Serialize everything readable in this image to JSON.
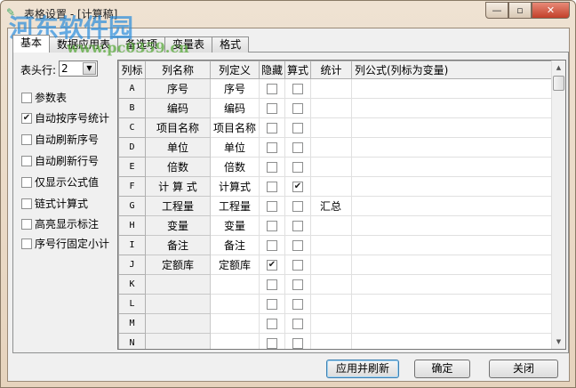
{
  "window": {
    "title": "表格设置 - [计算稿]",
    "minimize": "—",
    "maximize": "▫",
    "close": "✕"
  },
  "watermark": {
    "site": "河东软件园",
    "url": "www.pc0359.cn"
  },
  "tabs": [
    {
      "label": "基本",
      "active": true
    },
    {
      "label": "数据应用表"
    },
    {
      "label": "备选项"
    },
    {
      "label": "变量表"
    },
    {
      "label": "格式"
    }
  ],
  "header_rows": {
    "label": "表头行:",
    "value": "2"
  },
  "options": [
    {
      "label": "参数表",
      "checked": false
    },
    {
      "label": "自动按序号统计",
      "checked": true
    },
    {
      "label": "自动刷新序号",
      "checked": false
    },
    {
      "label": "自动刷新行号",
      "checked": false
    },
    {
      "label": "仅显示公式值",
      "checked": false
    },
    {
      "label": "链式计算式",
      "checked": false
    },
    {
      "label": "高亮显示标注",
      "checked": false
    },
    {
      "label": "序号行固定小计",
      "checked": false
    }
  ],
  "grid": {
    "columns": [
      "列标",
      "列名称",
      "列定义",
      "隐藏",
      "算式",
      "统计",
      "列公式(列标为变量)"
    ],
    "rows": [
      {
        "id": "A",
        "name": "序号",
        "def": "序号",
        "hide": false,
        "formula": false,
        "stat": ""
      },
      {
        "id": "B",
        "name": "编码",
        "def": "编码",
        "hide": false,
        "formula": false,
        "stat": ""
      },
      {
        "id": "C",
        "name": "项目名称",
        "def": "项目名称",
        "hide": false,
        "formula": false,
        "stat": ""
      },
      {
        "id": "D",
        "name": "单位",
        "def": "单位",
        "hide": false,
        "formula": false,
        "stat": ""
      },
      {
        "id": "E",
        "name": "倍数",
        "def": "倍数",
        "hide": false,
        "formula": false,
        "stat": ""
      },
      {
        "id": "F",
        "name": "计 算 式",
        "def": "计算式",
        "hide": false,
        "formula": true,
        "stat": ""
      },
      {
        "id": "G",
        "name": "工程量",
        "def": "工程量",
        "hide": false,
        "formula": false,
        "stat": "汇总"
      },
      {
        "id": "H",
        "name": "变量",
        "def": "变量",
        "hide": false,
        "formula": false,
        "stat": ""
      },
      {
        "id": "I",
        "name": "备注",
        "def": "备注",
        "hide": false,
        "formula": false,
        "stat": ""
      },
      {
        "id": "J",
        "name": "定额库",
        "def": "定额库",
        "hide": true,
        "formula": false,
        "stat": ""
      },
      {
        "id": "K",
        "name": "",
        "def": "",
        "hide": false,
        "formula": false,
        "stat": ""
      },
      {
        "id": "L",
        "name": "",
        "def": "",
        "hide": false,
        "formula": false,
        "stat": ""
      },
      {
        "id": "M",
        "name": "",
        "def": "",
        "hide": false,
        "formula": false,
        "stat": ""
      },
      {
        "id": "N",
        "name": "",
        "def": "",
        "hide": false,
        "formula": false,
        "stat": ""
      }
    ]
  },
  "buttons": {
    "apply": "应用并刷新",
    "ok": "确定",
    "close": "关闭"
  }
}
